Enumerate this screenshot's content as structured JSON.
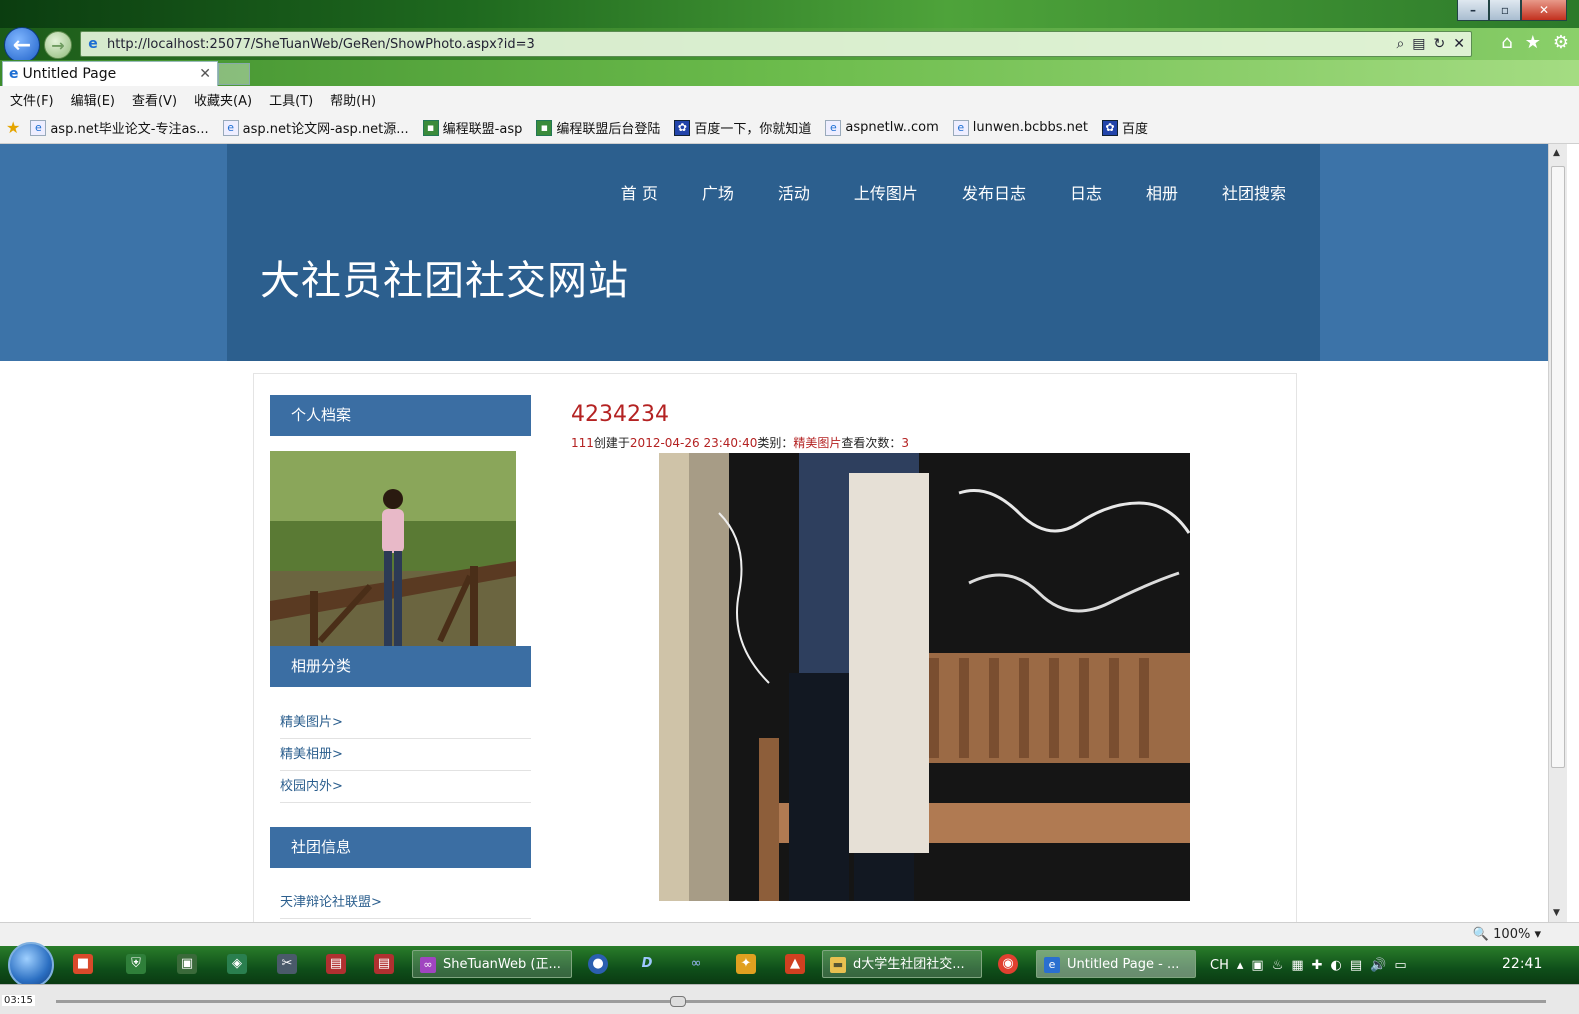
{
  "browser": {
    "address_url": "http://localhost:25077/SheTuanWeb/GeRen/ShowPhoto.aspx?id=3",
    "tab_title": "Untitled Page",
    "menu": [
      "文件(F)",
      "编辑(E)",
      "查看(V)",
      "收藏夹(A)",
      "工具(T)",
      "帮助(H)"
    ],
    "favorites": [
      {
        "label": "asp.net毕业论文-专注as...",
        "icon": "ie-page-icon"
      },
      {
        "label": "asp.net论文网-asp.net源...",
        "icon": "ie-page-icon"
      },
      {
        "label": "编程联盟-asp",
        "icon": "green-site-icon"
      },
      {
        "label": "编程联盟后台登陆",
        "icon": "green-site-icon"
      },
      {
        "label": "百度一下，你就知道",
        "icon": "paw-icon"
      },
      {
        "label": "aspnetlw..com",
        "icon": "ie-page-icon"
      },
      {
        "label": "lunwen.bcbbs.net",
        "icon": "ie-page-icon"
      },
      {
        "label": "百度",
        "icon": "paw-icon"
      }
    ],
    "zoom": "100%"
  },
  "site": {
    "nav": [
      "首 页",
      "广场",
      "活动",
      "上传图片",
      "发布日志",
      "日志",
      "相册",
      "社团搜索"
    ],
    "title": "大社员社团社交网站",
    "colors": {
      "header_outer": "#3c73a8",
      "header_inner": "#2c5f8e",
      "panel": "#3b6ea3",
      "accent_red": "#b42222"
    }
  },
  "sidebar": {
    "profile_heading": "个人档案",
    "album_heading": "相册分类",
    "album_categories": [
      "精美图片>",
      "精美相册>",
      "校园内外>"
    ],
    "club_heading": "社团信息",
    "clubs": [
      "天津辩论社联盟>"
    ]
  },
  "photo": {
    "title": "4234234",
    "author": "111",
    "created_label": "创建于",
    "created_at": "2012-04-26 23:40:40",
    "category_label": "类别：",
    "category": "精美图片",
    "views_label": "查看次数：",
    "views": "3"
  },
  "taskbar": {
    "tasks": [
      {
        "label": "SheTuanWeb (正...",
        "icon": "vs-icon"
      },
      {
        "label": "d大学生社团社交...",
        "icon": "folder-icon"
      },
      {
        "label": "Untitled Page - ...",
        "icon": "ie-icon"
      }
    ],
    "tray_lang": "CH",
    "clock": "22:41"
  },
  "player": {
    "time": "03:15"
  }
}
